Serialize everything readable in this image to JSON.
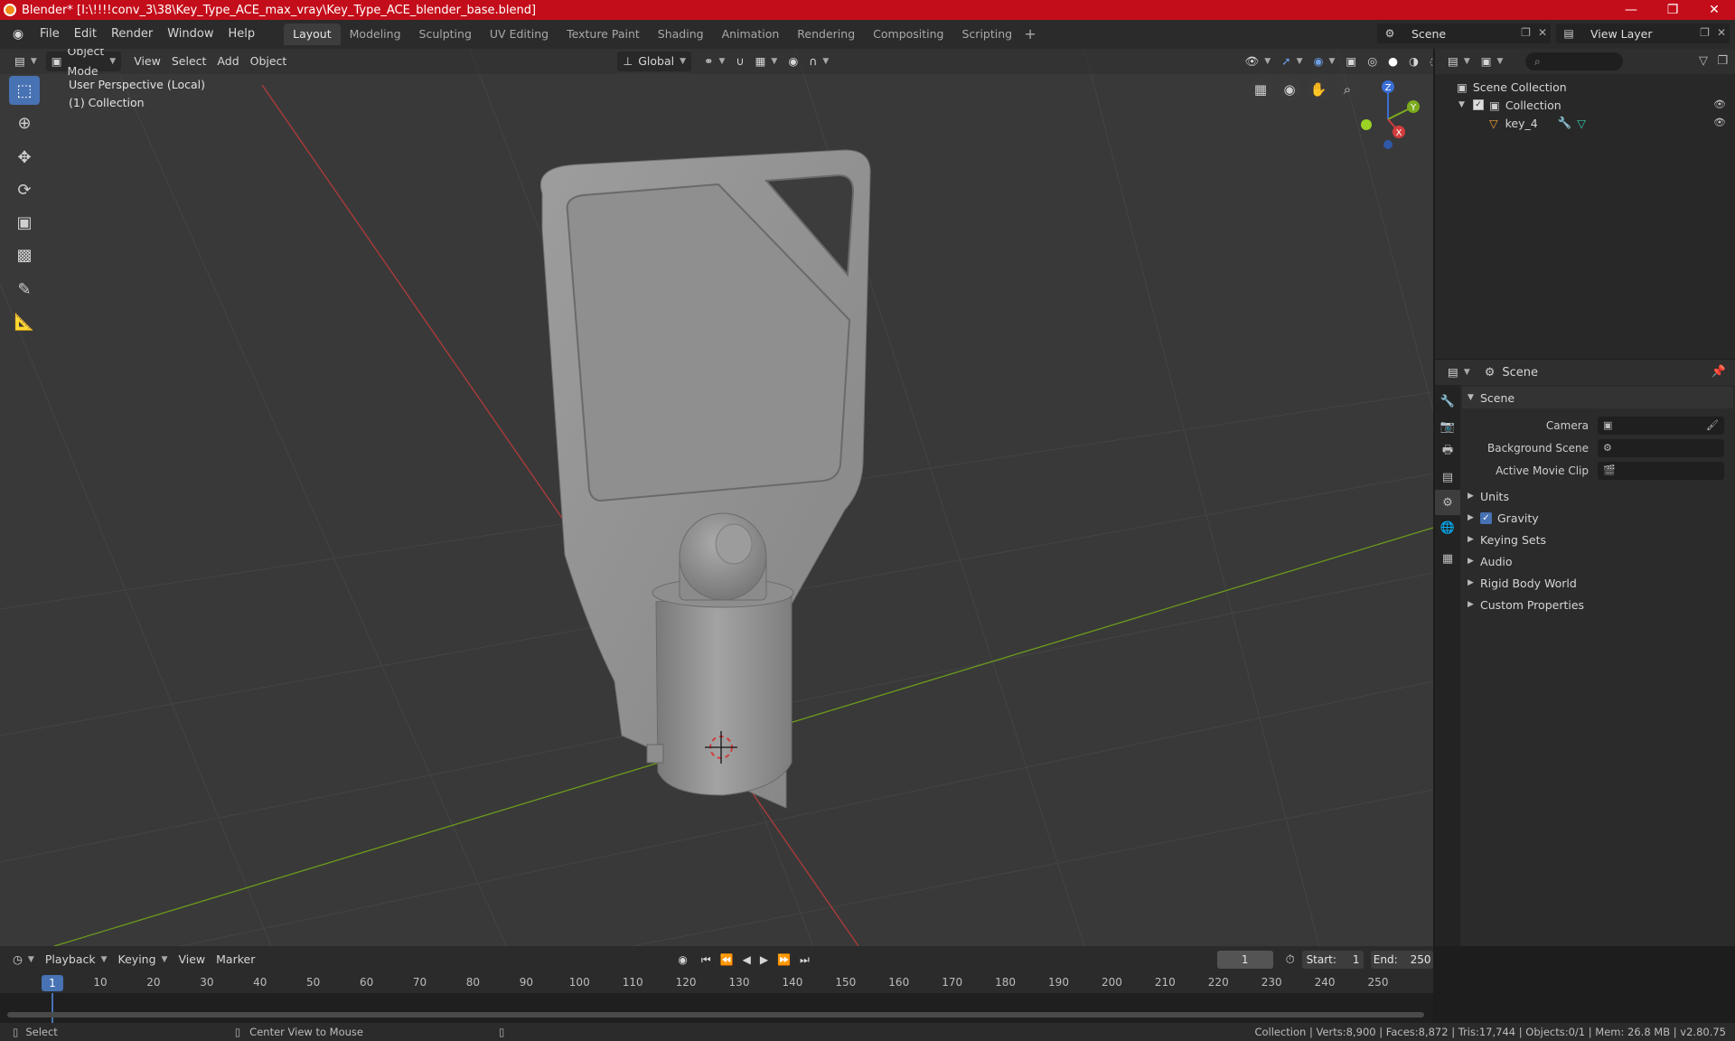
{
  "window": {
    "title": "Blender* [I:\\!!!!conv_3\\38\\Key_Type_ACE_max_vray\\Key_Type_ACE_blender_base.blend]",
    "minimize_icon": "minimize-icon",
    "maximize_icon": "restore-icon",
    "close_icon": "close-icon"
  },
  "menubar": {
    "items": [
      "File",
      "Edit",
      "Render",
      "Window",
      "Help"
    ],
    "workspaces": [
      "Layout",
      "Modeling",
      "Sculpting",
      "UV Editing",
      "Texture Paint",
      "Shading",
      "Animation",
      "Rendering",
      "Compositing",
      "Scripting"
    ],
    "active_workspace": "Layout",
    "add_symbol": "+",
    "scene_value": "Scene",
    "view_layer_value": "View Layer"
  },
  "viewport": {
    "mode": "Object Mode",
    "menus": [
      "View",
      "Select",
      "Add",
      "Object"
    ],
    "orientation": "Global",
    "info_line1": "User Perspective (Local)",
    "info_line2": "(1) Collection",
    "gizmo": {
      "x": "X",
      "y": "Y",
      "z": "Z"
    }
  },
  "outliner": {
    "search_placeholder": "",
    "scene_collection": "Scene Collection",
    "collection": "Collection",
    "object": "key_4"
  },
  "properties": {
    "header": "Scene",
    "panel_title": "Scene",
    "camera_label": "Camera",
    "background_scene_label": "Background Scene",
    "active_movie_clip_label": "Active Movie Clip",
    "subpanels": [
      "Units",
      "Gravity",
      "Keying Sets",
      "Audio",
      "Rigid Body World",
      "Custom Properties"
    ]
  },
  "timeline": {
    "menus": [
      "Playback",
      "Keying",
      "View",
      "Marker"
    ],
    "current_frame": "1",
    "start_label": "Start:",
    "start_value": "1",
    "end_label": "End:",
    "end_value": "250",
    "ticks": [
      "1",
      "10",
      "20",
      "30",
      "40",
      "50",
      "60",
      "70",
      "80",
      "90",
      "100",
      "110",
      "120",
      "130",
      "140",
      "150",
      "160",
      "170",
      "180",
      "190",
      "200",
      "210",
      "220",
      "230",
      "240",
      "250"
    ]
  },
  "statusbar": {
    "select": "Select",
    "center_view": "Center View to Mouse",
    "stats": "Collection | Verts:8,900 | Faces:8,872 | Tris:17,744 | Objects:0/1 | Mem: 26.8 MB | v2.80.75"
  },
  "colors": {
    "titlebar": "#c40d1a",
    "accent": "#4772b3",
    "viewport_bg": "#393939",
    "x_axis": "#b33a3a",
    "y_axis": "#6d9a1c"
  }
}
